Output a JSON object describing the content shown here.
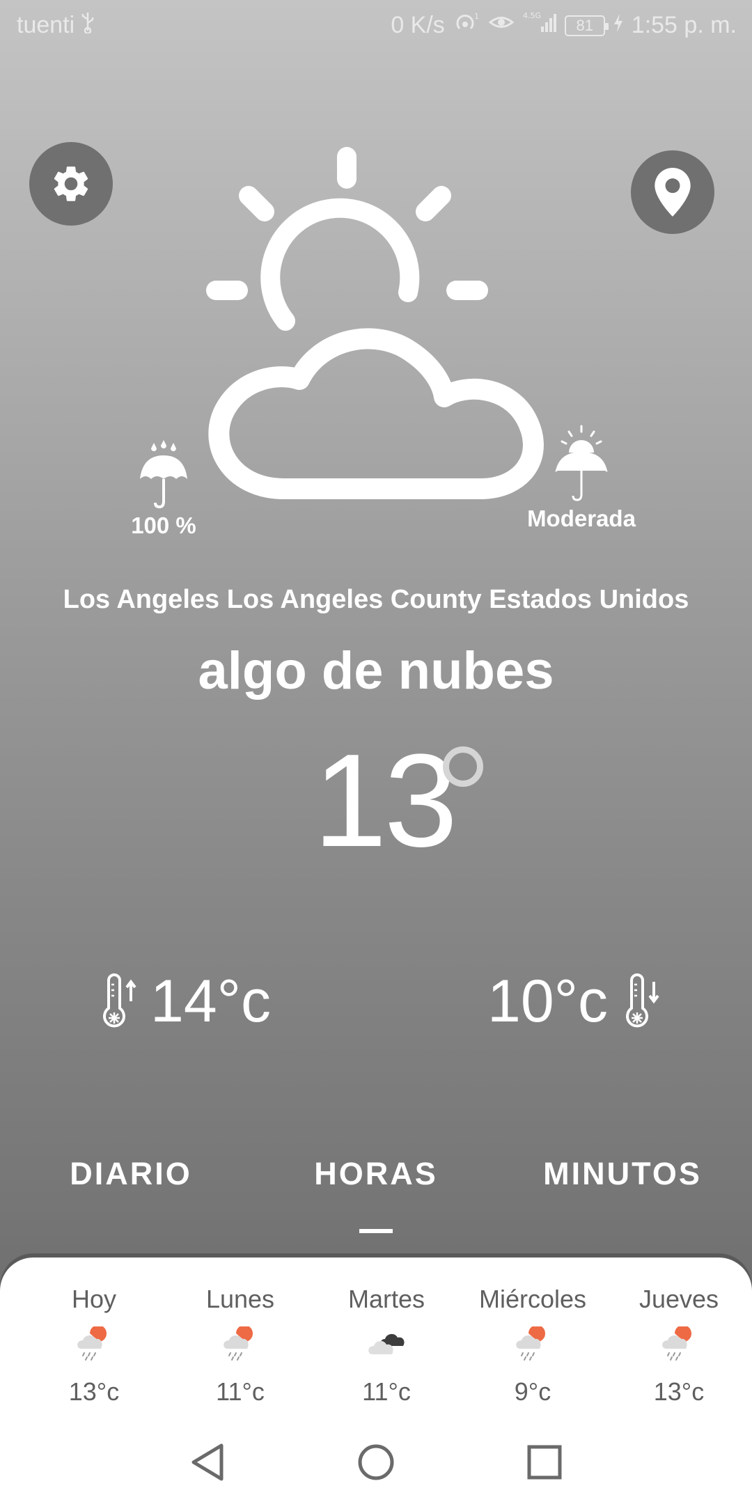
{
  "status_bar": {
    "carrier": "tuenti",
    "speed": "0 K/s",
    "network": "4.5G",
    "battery": "81",
    "time": "1:55 p. m."
  },
  "current": {
    "rain_probability": "100 %",
    "uv_index": "Moderada",
    "location": "Los Angeles  Los Angeles County Estados Unidos",
    "condition": "algo de nubes",
    "temperature": "13",
    "max_temp": "14°c",
    "min_temp": "10°c"
  },
  "tabs": [
    {
      "label": "DIARIO"
    },
    {
      "label": "HORAS"
    },
    {
      "label": "MINUTOS"
    }
  ],
  "selected_tab": "HORAS",
  "forecast": [
    {
      "day": "Hoy",
      "temp": "13°c",
      "icon": "rain-sun-icon"
    },
    {
      "day": "Lunes",
      "temp": "11°c",
      "icon": "rain-sun-icon"
    },
    {
      "day": "Martes",
      "temp": "11°c",
      "icon": "dark-cloud-icon"
    },
    {
      "day": "Miércoles",
      "temp": "9°c",
      "icon": "rain-sun-icon"
    },
    {
      "day": "Jueves",
      "temp": "13°c",
      "icon": "rain-sun-icon"
    }
  ],
  "colors": {
    "accent_sun": "#ee6a44",
    "text_dark": "#5f5f5f"
  }
}
